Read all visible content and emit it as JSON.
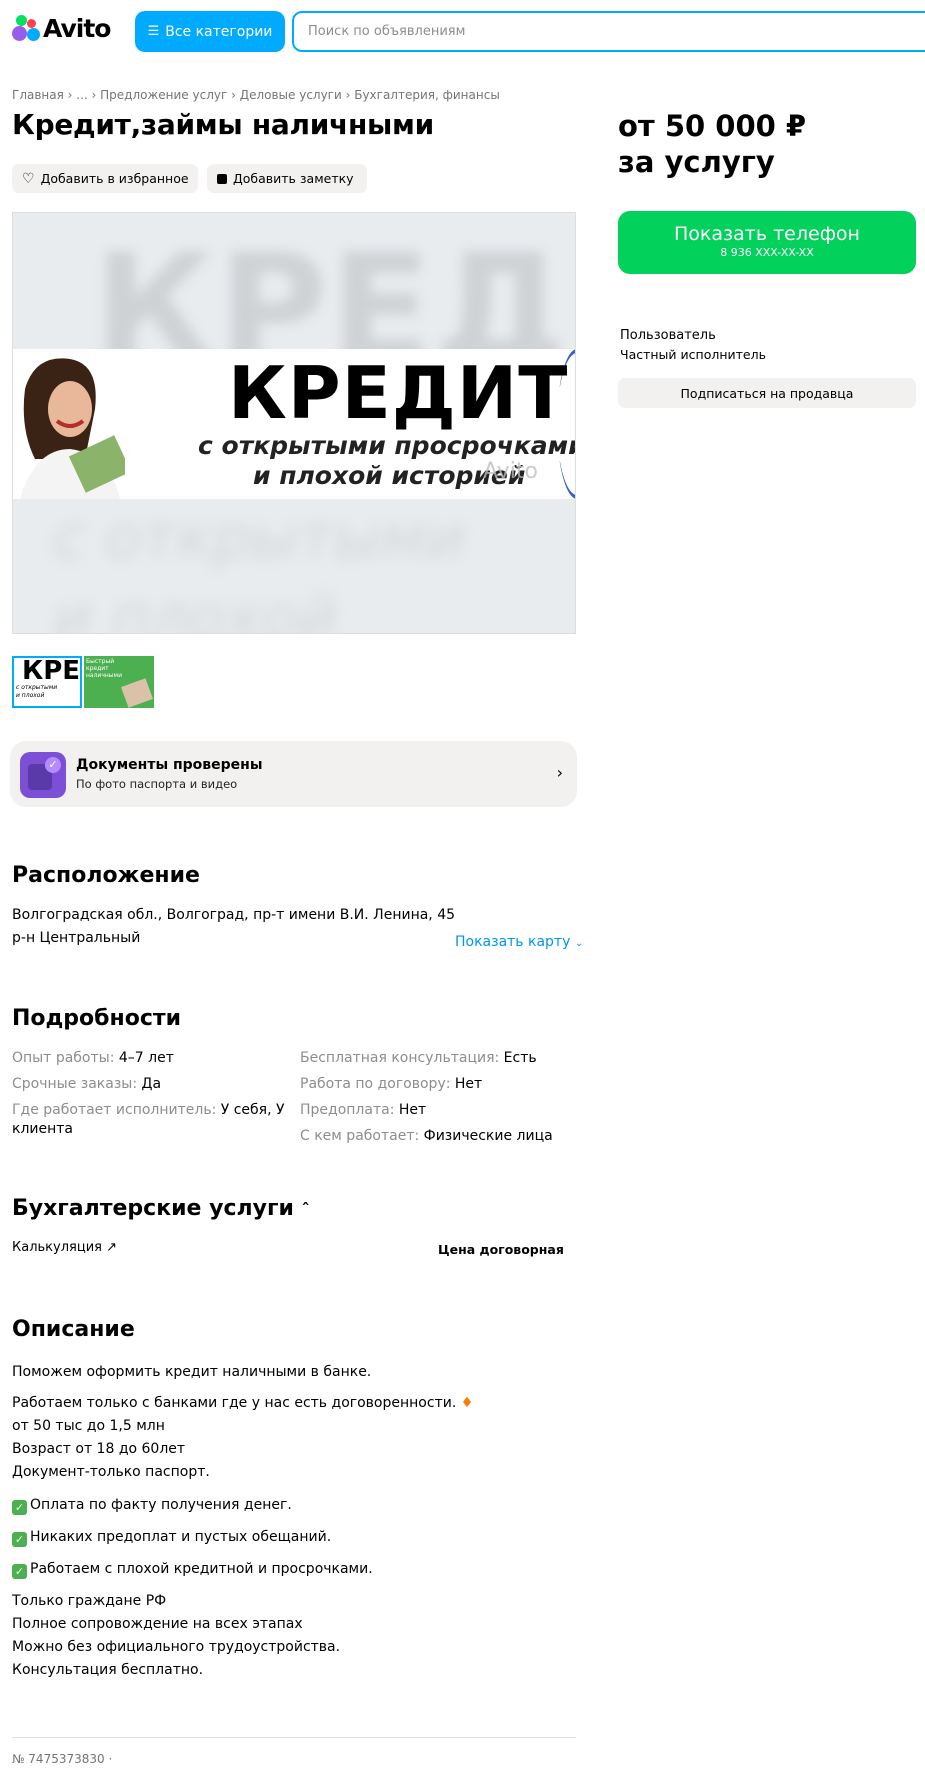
{
  "header": {
    "logo_text": "Avito",
    "categories_label": "Все категории",
    "search_placeholder": "Поиск по объявлениям"
  },
  "breadcrumbs": "Главная › ... › Предложение услуг › Деловые услуги › Бухгалтерия, финансы",
  "title": "Кредит,займы наличными",
  "actions": {
    "favorite": "Добавить в избранное",
    "note": "Добавить заметку"
  },
  "photo": {
    "main_text": "КРЕДИТ",
    "line2": "с открытыми просрочками",
    "line3": "и плохой историей",
    "watermark": "Avito",
    "thumb1_text": "КРЕД",
    "thumb2_text": "Быстрый кредит наличными"
  },
  "verification": {
    "title": "Документы проверены",
    "subtitle": "По фото паспорта и видео"
  },
  "location": {
    "heading": "Расположение",
    "address": "Волгоградская обл., Волгоград, пр-т имени В.И. Ленина, 45",
    "district": "р-н Центральный",
    "map_link": "Показать карту"
  },
  "details": {
    "heading": "Подробности",
    "left": [
      {
        "k": "Опыт работы: ",
        "v": "4–7 лет"
      },
      {
        "k": "Срочные заказы: ",
        "v": "Да"
      },
      {
        "k": "Где работает исполнитель: ",
        "v": "У себя, У"
      },
      {
        "k": "",
        "v": "клиента"
      }
    ],
    "right": [
      {
        "k": "Бесплатная консультация: ",
        "v": "Есть"
      },
      {
        "k": "Работа по договору: ",
        "v": "Нет"
      },
      {
        "k": "Предоплата: ",
        "v": "Нет"
      },
      {
        "k": "С кем работает: ",
        "v": "Физические лица"
      }
    ]
  },
  "services": {
    "heading": "Бухгалтерские услуги",
    "item": "Калькуляция",
    "price": "Цена договорная"
  },
  "description": {
    "heading": "Описание",
    "p1": "Поможем оформить кредит наличными в банке.",
    "p2": "Работаем только с банками где у нас есть договоренности.",
    "p3": "от 50 тыс до 1,5 млн",
    "p4": "Возраст от 18 до 60лет",
    "p5": "Документ-только паспорт.",
    "c1": "Оплата по факту получения денег.",
    "c2": "Никаких предоплат и пустых обещаний.",
    "c3": "Работаем с плохой кредитной и просрочками.",
    "p6": "Только граждане РФ",
    "p7": "Полное сопровождение на всех этапах",
    "p8": "Можно без официального трудоустройства.",
    "p9": "Консультация бесплатно."
  },
  "ad_number": "№ 7475373830 ·",
  "sidebar": {
    "price_line1": "от 50 000 ₽",
    "price_line2": "за услугу",
    "phone_label": "Показать телефон",
    "phone_masked": "8 936 XXX-XX-XX",
    "seller_name": "Пользователь",
    "seller_type": "Частный исполнитель",
    "subscribe": "Подписаться на продавца"
  },
  "colors": {
    "accent_blue": "#00AAFF",
    "phone_green": "#02D15C",
    "link_blue": "#0096ea",
    "chip_gray": "#f2f1f0"
  }
}
